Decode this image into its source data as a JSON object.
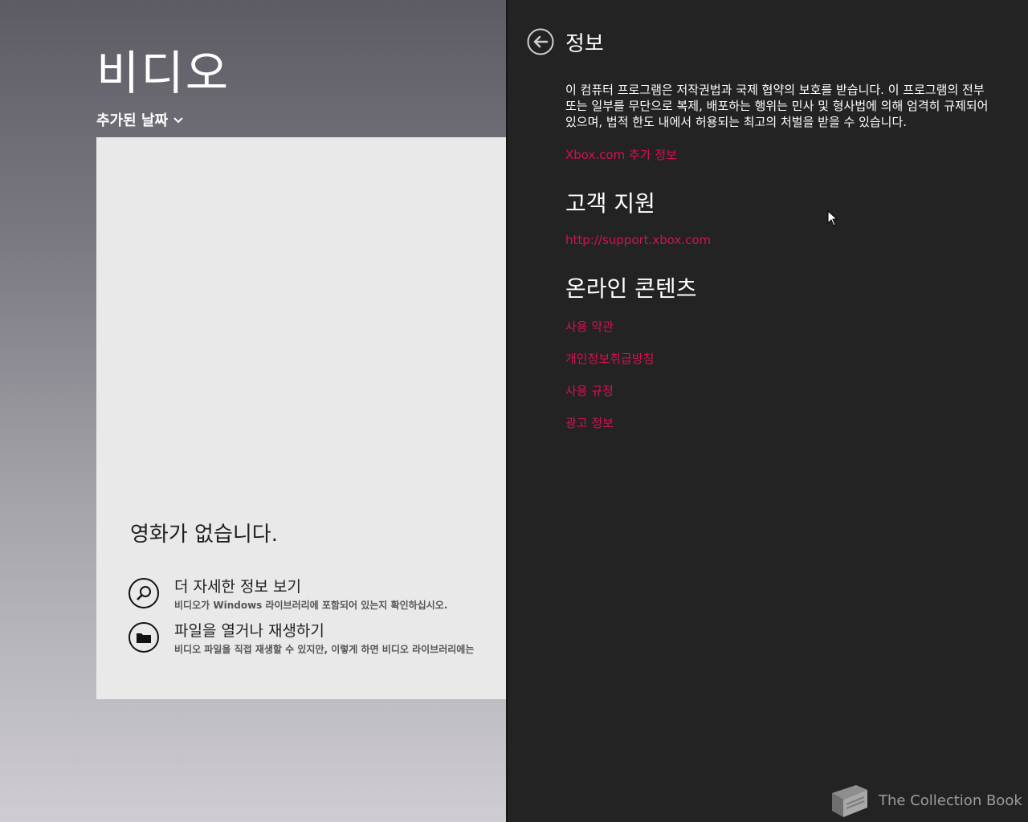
{
  "app": {
    "title": "비디오",
    "sort_label": "추가된 날짜",
    "empty_heading": "영화가 없습니다.",
    "actions": [
      {
        "title": "더 자세한 정보 보기",
        "desc": "비디오가 Windows 라이브러리에 포함되어 있는지 확인하십시오.",
        "icon": "search-icon"
      },
      {
        "title": "파일을 열거나 재생하기",
        "desc": "비디오 파일을 직접 재생할 수 있지만, 이렇게 하면 비디오 라이브러리에는",
        "icon": "folder-icon"
      }
    ]
  },
  "panel": {
    "title": "정보",
    "legal_text": "이 컴퓨터 프로그램은 저작권법과 국제 협약의 보호를 받습니다. 이 프로그램의 전부 또는 일부를 무단으로 복제, 배포하는 행위는 민사 및 형사법에 의해 엄격히 규제되어 있으며, 법적 한도 내에서 허용되는 최고의 처벌을 받을 수 있습니다.",
    "xbox_link": "Xbox.com 추가 정보",
    "support_heading": "고객 지원",
    "support_link": "http://support.xbox.com",
    "online_heading": "온라인 콘텐츠",
    "online_links": [
      "사용 약관",
      "개인정보취급방침",
      "사용 규정",
      "광고 정보"
    ]
  },
  "watermark": "The Collection Book",
  "colors": {
    "accent": "#d4124e",
    "panel_bg": "#232323",
    "card_bg": "#e9e9e9"
  }
}
